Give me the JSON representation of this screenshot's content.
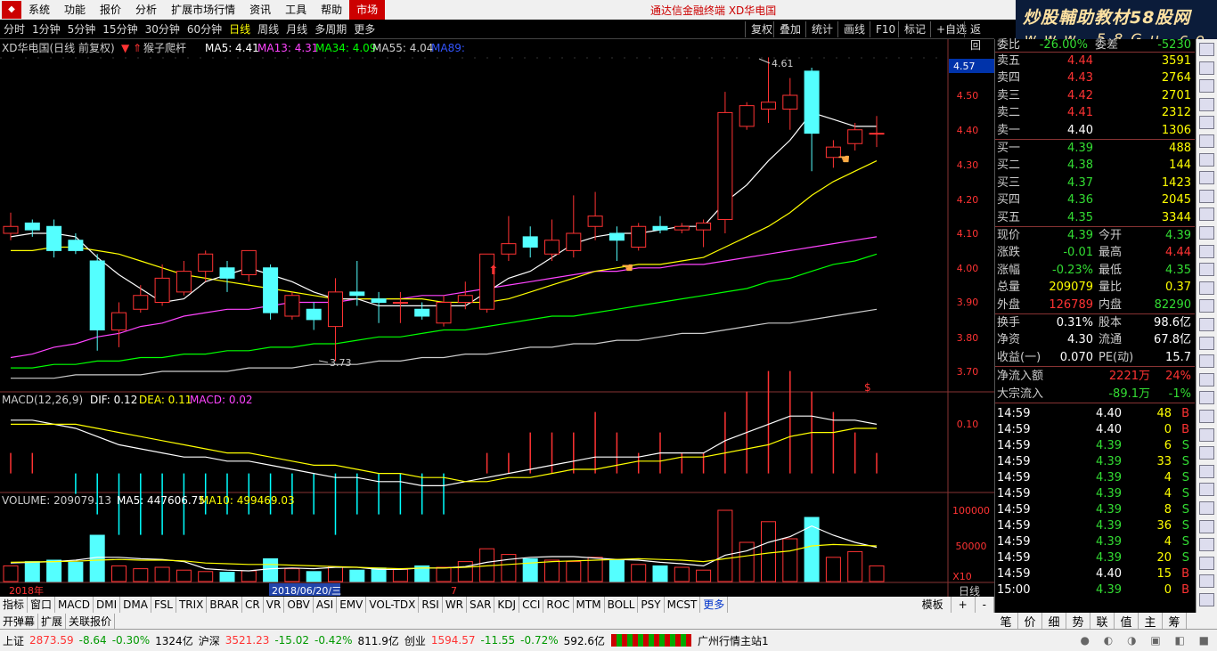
{
  "menu": {
    "items": [
      "系统",
      "功能",
      "报价",
      "分析",
      "扩展市场行情",
      "资讯",
      "工具",
      "帮助"
    ],
    "active_tab": "市场",
    "app_title": "通达信金融终端 XD华电国"
  },
  "banner": {
    "line1": "炒股輔助教材58股网",
    "line2": "w w w . 5 8 G u . c o m"
  },
  "periods": {
    "items": [
      "分时",
      "1分钟",
      "5分钟",
      "15分钟",
      "30分钟",
      "60分钟",
      "日线",
      "周线",
      "月线",
      "多周期",
      "更多"
    ],
    "active": "日线",
    "right_buttons": [
      "复权",
      "叠加",
      "统计",
      "画线",
      "F10",
      "标记",
      "+自选",
      "返回"
    ]
  },
  "kline_header": {
    "stock": "XD华电国(日线 前复权)",
    "indicator": "猴子爬杆",
    "ma5": "MA5: 4.41",
    "ma13": "MA13: 4.31",
    "ma34": "MA34: 4.09",
    "ma55": "MA55: 4.04",
    "ma_extra": "MA89:"
  },
  "price_axis": {
    "ticks": [
      "4.50",
      "4.40",
      "4.30",
      "4.20",
      "4.10",
      "4.00",
      "3.90",
      "3.80",
      "3.70"
    ],
    "current": "4.57",
    "high_label": "4.61",
    "low_label": "3.73"
  },
  "macd_header": {
    "name": "MACD(12,26,9)",
    "dif": "DIF: 0.12",
    "dea": "DEA: 0.11",
    "macd": "MACD: 0.02",
    "axis_tick": "0.10"
  },
  "volume_header": {
    "name": "VOLUME: 209079.13",
    "ma5": "MA5: 447606.75",
    "ma10": "MA10: 499469.03",
    "ticks": [
      "100000",
      "50000",
      "X10"
    ]
  },
  "time_axis": {
    "year": "2018年",
    "date_box": "2018/06/20/三",
    "month": "7",
    "period_label": "日线"
  },
  "indicator_tabs": [
    "指标",
    "窗口",
    "MACD",
    "DMI",
    "DMA",
    "FSL",
    "TRIX",
    "BRAR",
    "CR",
    "VR",
    "OBV",
    "ASI",
    "EMV",
    "VOL-TDX",
    "RSI",
    "WR",
    "SAR",
    "KDJ",
    "CCI",
    "ROC",
    "MTM",
    "BOLL",
    "PSY",
    "MCST",
    "更多"
  ],
  "indicator_tabs_right": [
    "模板",
    "+",
    "-"
  ],
  "quick_bar": [
    "开弹幕",
    "扩展",
    "关联报价"
  ],
  "orderbook": {
    "top": {
      "label": "委比",
      "value": "-26.00%",
      "label2": "委差",
      "value2": "-5230"
    },
    "sells": [
      {
        "label": "卖五",
        "price": "4.44",
        "vol": "3591"
      },
      {
        "label": "卖四",
        "price": "4.43",
        "vol": "2764"
      },
      {
        "label": "卖三",
        "price": "4.42",
        "vol": "2701"
      },
      {
        "label": "卖二",
        "price": "4.41",
        "vol": "2312"
      },
      {
        "label": "卖一",
        "price": "4.40",
        "vol": "1306"
      }
    ],
    "buys": [
      {
        "label": "买一",
        "price": "4.39",
        "vol": "488"
      },
      {
        "label": "买二",
        "price": "4.38",
        "vol": "144"
      },
      {
        "label": "买三",
        "price": "4.37",
        "vol": "1423"
      },
      {
        "label": "买四",
        "price": "4.36",
        "vol": "2045"
      },
      {
        "label": "买五",
        "price": "4.35",
        "vol": "3344"
      }
    ]
  },
  "quote": [
    {
      "l1": "现价",
      "v1": "4.39",
      "l2": "今开",
      "v2": "4.39"
    },
    {
      "l1": "涨跌",
      "v1": "-0.01",
      "l2": "最高",
      "v2": "4.44"
    },
    {
      "l1": "涨幅",
      "v1": "-0.23%",
      "l2": "最低",
      "v2": "4.35"
    },
    {
      "l1": "总量",
      "v1": "209079",
      "l2": "量比",
      "v2": "0.37"
    },
    {
      "l1": "外盘",
      "v1": "126789",
      "l2": "内盘",
      "v2": "82290"
    }
  ],
  "fundamentals": [
    {
      "l1": "换手",
      "v1": "0.31%",
      "l2": "股本",
      "v2": "98.6亿"
    },
    {
      "l1": "净资",
      "v1": "4.30",
      "l2": "流通",
      "v2": "67.8亿"
    },
    {
      "l1": "收益(一)",
      "v1": "0.070",
      "l2": "PE(动)",
      "v2": "15.7"
    }
  ],
  "flows": [
    {
      "label": "净流入额",
      "value": "2221万",
      "pct": "24%"
    },
    {
      "label": "大宗流入",
      "value": "-89.1万",
      "pct": "-1%"
    }
  ],
  "ticks": [
    {
      "t": "14:59",
      "p": "4.40",
      "v": "48",
      "s": "B"
    },
    {
      "t": "14:59",
      "p": "4.40",
      "v": "0",
      "s": "B"
    },
    {
      "t": "14:59",
      "p": "4.39",
      "v": "6",
      "s": "S"
    },
    {
      "t": "14:59",
      "p": "4.39",
      "v": "33",
      "s": "S"
    },
    {
      "t": "14:59",
      "p": "4.39",
      "v": "4",
      "s": "S"
    },
    {
      "t": "14:59",
      "p": "4.39",
      "v": "4",
      "s": "S"
    },
    {
      "t": "14:59",
      "p": "4.39",
      "v": "8",
      "s": "S"
    },
    {
      "t": "14:59",
      "p": "4.39",
      "v": "36",
      "s": "S"
    },
    {
      "t": "14:59",
      "p": "4.39",
      "v": "4",
      "s": "S"
    },
    {
      "t": "14:59",
      "p": "4.39",
      "v": "20",
      "s": "S"
    },
    {
      "t": "14:59",
      "p": "4.40",
      "v": "15",
      "s": "B"
    },
    {
      "t": "15:00",
      "p": "4.39",
      "v": "0",
      "s": "B"
    }
  ],
  "right_bottom_tabs": [
    "笔",
    "价",
    "细",
    "势",
    "联",
    "值",
    "主",
    "筹"
  ],
  "status": {
    "sh_label": "上证",
    "sh_value": "2873.59",
    "sh_chg": "-8.64",
    "sh_pct": "-0.30%",
    "sh_amt": "1324亿",
    "sz_label": "沪深",
    "sz_value": "3521.23",
    "sz_chg": "-15.02",
    "sz_pct": "-0.42%",
    "sz_amt": "811.9亿",
    "cy_label": "创业",
    "cy_value": "1594.57",
    "cy_chg": "-11.55",
    "cy_pct": "-0.72%",
    "cy_amt": "592.6亿",
    "server": "广州行情主站1"
  },
  "colors": {
    "up": "#ff3333",
    "down": "#54ffff",
    "ma5": "#ffffff",
    "ma13": "#ffff00",
    "ma34": "#ff44ff",
    "ma55": "#00ff00",
    "ma89": "#cccccc"
  },
  "chart_data": {
    "type": "candlestick",
    "title": "XD华电国(日线 前复权)",
    "ylim": [
      3.66,
      4.6
    ],
    "candles": [
      {
        "o": 4.1,
        "c": 4.12,
        "h": 4.16,
        "l": 4.08
      },
      {
        "o": 4.13,
        "c": 4.11,
        "h": 4.14,
        "l": 4.09
      },
      {
        "o": 4.12,
        "c": 4.05,
        "h": 4.14,
        "l": 4.03
      },
      {
        "o": 4.08,
        "c": 4.05,
        "h": 4.1,
        "l": 4.04
      },
      {
        "o": 4.02,
        "c": 3.82,
        "h": 4.04,
        "l": 3.76
      },
      {
        "o": 3.82,
        "c": 3.87,
        "h": 3.9,
        "l": 3.77
      },
      {
        "o": 3.88,
        "c": 3.92,
        "h": 3.95,
        "l": 3.87
      },
      {
        "o": 3.9,
        "c": 3.97,
        "h": 4.01,
        "l": 3.89
      },
      {
        "o": 3.93,
        "c": 3.99,
        "h": 4.02,
        "l": 3.92
      },
      {
        "o": 3.99,
        "c": 4.04,
        "h": 4.05,
        "l": 3.96
      },
      {
        "o": 4.0,
        "c": 3.97,
        "h": 4.02,
        "l": 3.93
      },
      {
        "o": 3.98,
        "c": 4.05,
        "h": 4.05,
        "l": 3.96
      },
      {
        "o": 4.0,
        "c": 3.87,
        "h": 4.01,
        "l": 3.85
      },
      {
        "o": 3.86,
        "c": 3.92,
        "h": 3.93,
        "l": 3.85
      },
      {
        "o": 3.88,
        "c": 3.85,
        "h": 3.9,
        "l": 3.82
      },
      {
        "o": 3.83,
        "c": 3.93,
        "h": 3.97,
        "l": 3.73
      },
      {
        "o": 3.93,
        "c": 3.92,
        "h": 4.02,
        "l": 3.89
      },
      {
        "o": 3.91,
        "c": 3.9,
        "h": 3.93,
        "l": 3.84
      },
      {
        "o": 3.9,
        "c": 3.9,
        "h": 3.93,
        "l": 3.84
      },
      {
        "o": 3.88,
        "c": 3.86,
        "h": 3.9,
        "l": 3.85
      },
      {
        "o": 3.84,
        "c": 3.9,
        "h": 3.92,
        "l": 3.83
      },
      {
        "o": 3.9,
        "c": 3.92,
        "h": 3.96,
        "l": 3.88
      },
      {
        "o": 3.88,
        "c": 4.04,
        "h": 4.04,
        "l": 3.87
      },
      {
        "o": 4.04,
        "c": 4.07,
        "h": 4.15,
        "l": 4.02
      },
      {
        "o": 4.09,
        "c": 4.06,
        "h": 4.12,
        "l": 4.03
      },
      {
        "o": 4.04,
        "c": 4.08,
        "h": 4.14,
        "l": 4.02
      },
      {
        "o": 4.05,
        "c": 4.1,
        "h": 4.21,
        "l": 4.03
      },
      {
        "o": 4.12,
        "c": 4.15,
        "h": 4.22,
        "l": 4.08
      },
      {
        "o": 4.1,
        "c": 4.08,
        "h": 4.12,
        "l": 4.02
      },
      {
        "o": 4.06,
        "c": 4.12,
        "h": 4.13,
        "l": 4.05
      },
      {
        "o": 4.12,
        "c": 4.11,
        "h": 4.15,
        "l": 4.1
      },
      {
        "o": 4.11,
        "c": 4.12,
        "h": 4.13,
        "l": 4.1
      },
      {
        "o": 4.11,
        "c": 4.13,
        "h": 4.14,
        "l": 4.06
      },
      {
        "o": 4.14,
        "c": 4.45,
        "h": 4.51,
        "l": 4.1
      },
      {
        "o": 4.41,
        "c": 4.47,
        "h": 4.48,
        "l": 4.4
      },
      {
        "o": 4.46,
        "c": 4.48,
        "h": 4.61,
        "l": 4.42
      },
      {
        "o": 4.46,
        "c": 4.5,
        "h": 4.55,
        "l": 4.4
      },
      {
        "o": 4.57,
        "c": 4.39,
        "h": 4.58,
        "l": 4.28
      },
      {
        "o": 4.32,
        "c": 4.35,
        "h": 4.37,
        "l": 4.29
      },
      {
        "o": 4.36,
        "c": 4.4,
        "h": 4.42,
        "l": 4.34
      },
      {
        "o": 4.39,
        "c": 4.39,
        "h": 4.44,
        "l": 4.35
      }
    ],
    "ma5": [
      4.09,
      4.1,
      4.1,
      4.09,
      4.03,
      3.98,
      3.94,
      3.9,
      3.91,
      3.96,
      3.98,
      4.0,
      3.98,
      3.96,
      3.93,
      3.91,
      3.91,
      3.89,
      3.89,
      3.89,
      3.89,
      3.89,
      3.93,
      3.97,
      3.99,
      4.03,
      4.07,
      4.09,
      4.1,
      4.1,
      4.11,
      4.12,
      4.12,
      4.19,
      4.24,
      4.31,
      4.37,
      4.45,
      4.43,
      4.41,
      4.41
    ],
    "ma13": [
      4.05,
      4.05,
      4.06,
      4.06,
      4.05,
      4.04,
      4.02,
      4.0,
      3.98,
      3.97,
      3.96,
      3.95,
      3.94,
      3.93,
      3.92,
      3.91,
      3.91,
      3.91,
      3.91,
      3.91,
      3.9,
      3.9,
      3.9,
      3.91,
      3.93,
      3.95,
      3.97,
      3.99,
      4.0,
      4.01,
      4.01,
      4.02,
      4.03,
      4.06,
      4.09,
      4.12,
      4.16,
      4.21,
      4.25,
      4.28,
      4.31
    ],
    "ma34": [
      3.74,
      3.75,
      3.77,
      3.78,
      3.8,
      3.81,
      3.83,
      3.84,
      3.86,
      3.87,
      3.88,
      3.88,
      3.89,
      3.9,
      3.9,
      3.9,
      3.91,
      3.91,
      3.91,
      3.92,
      3.92,
      3.93,
      3.94,
      3.95,
      3.96,
      3.97,
      3.98,
      3.99,
      3.99,
      4.0,
      4.0,
      4.01,
      4.01,
      4.02,
      4.03,
      4.04,
      4.05,
      4.06,
      4.07,
      4.08,
      4.09
    ],
    "ma55": [
      3.71,
      3.71,
      3.72,
      3.72,
      3.73,
      3.73,
      3.74,
      3.74,
      3.75,
      3.75,
      3.76,
      3.76,
      3.77,
      3.77,
      3.78,
      3.78,
      3.79,
      3.8,
      3.8,
      3.81,
      3.82,
      3.82,
      3.83,
      3.84,
      3.85,
      3.86,
      3.86,
      3.87,
      3.88,
      3.89,
      3.9,
      3.91,
      3.92,
      3.93,
      3.94,
      3.96,
      3.97,
      3.99,
      4.01,
      4.02,
      4.04
    ],
    "ma89": [
      3.68,
      3.68,
      3.68,
      3.69,
      3.69,
      3.69,
      3.69,
      3.7,
      3.7,
      3.7,
      3.7,
      3.71,
      3.71,
      3.71,
      3.72,
      3.72,
      3.72,
      3.73,
      3.73,
      3.74,
      3.74,
      3.75,
      3.75,
      3.76,
      3.77,
      3.77,
      3.78,
      3.78,
      3.79,
      3.79,
      3.8,
      3.81,
      3.81,
      3.82,
      3.83,
      3.84,
      3.84,
      3.85,
      3.86,
      3.87,
      3.88
    ],
    "volume": [
      22000,
      28000,
      30000,
      27000,
      65000,
      22000,
      18000,
      20000,
      16000,
      14000,
      13000,
      15000,
      32000,
      18000,
      14000,
      20000,
      16000,
      19000,
      17000,
      22000,
      20000,
      28000,
      46000,
      38000,
      32000,
      30000,
      28000,
      34000,
      30000,
      24000,
      22000,
      20000,
      16000,
      100000,
      55000,
      84000,
      60000,
      90000,
      34000,
      42000,
      22000
    ],
    "vol_ma5": [
      26000,
      27000,
      28000,
      30000,
      34000,
      34000,
      32000,
      31000,
      28000,
      18000,
      16000,
      15000,
      18000,
      19000,
      18000,
      20000,
      20000,
      17000,
      17000,
      19000,
      19000,
      21000,
      27000,
      31000,
      34000,
      35000,
      35000,
      33000,
      31000,
      30000,
      27000,
      25000,
      22000,
      37000,
      43000,
      55000,
      63000,
      78000,
      65000,
      55000,
      48000
    ],
    "vol_ma10": [
      27000,
      27500,
      28000,
      28500,
      30000,
      31000,
      30000,
      30000,
      29000,
      26000,
      25000,
      24000,
      24000,
      23000,
      22000,
      21000,
      20000,
      19000,
      18000,
      19000,
      19000,
      20000,
      22000,
      24000,
      26000,
      28000,
      29000,
      30000,
      31000,
      32000,
      31000,
      30000,
      28000,
      32000,
      36000,
      40000,
      43000,
      50000,
      52000,
      51000,
      50000
    ],
    "dif": [
      0.13,
      0.13,
      0.12,
      0.11,
      0.09,
      0.07,
      0.06,
      0.05,
      0.04,
      0.04,
      0.03,
      0.03,
      0.02,
      0.01,
      0.0,
      -0.01,
      -0.01,
      -0.02,
      -0.02,
      -0.03,
      -0.03,
      -0.02,
      -0.01,
      0.0,
      0.01,
      0.02,
      0.03,
      0.04,
      0.04,
      0.04,
      0.05,
      0.05,
      0.05,
      0.08,
      0.1,
      0.12,
      0.14,
      0.14,
      0.13,
      0.13,
      0.12
    ],
    "dea": [
      0.12,
      0.12,
      0.12,
      0.12,
      0.11,
      0.1,
      0.09,
      0.08,
      0.07,
      0.06,
      0.05,
      0.05,
      0.04,
      0.03,
      0.02,
      0.02,
      0.01,
      0.0,
      0.0,
      -0.01,
      -0.01,
      -0.02,
      -0.02,
      -0.01,
      -0.01,
      0.0,
      0.01,
      0.01,
      0.02,
      0.03,
      0.03,
      0.04,
      0.04,
      0.05,
      0.06,
      0.07,
      0.09,
      0.1,
      0.1,
      0.11,
      0.11
    ],
    "macd_ylim": [
      -0.04,
      0.16
    ]
  }
}
